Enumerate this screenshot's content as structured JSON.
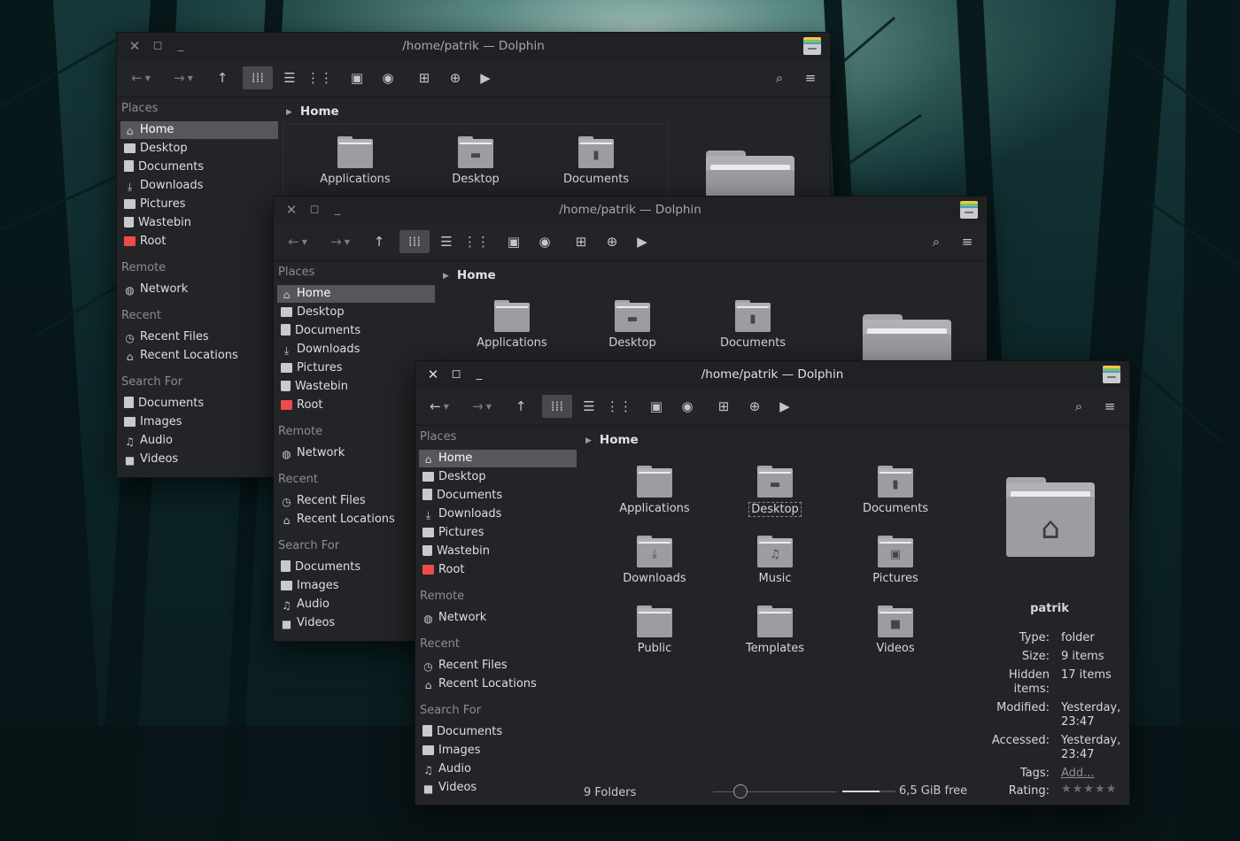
{
  "window": {
    "title": "/home/patrik — Dolphin",
    "breadcrumb": "Home"
  },
  "sidebar": {
    "places_label": "Places",
    "places": [
      {
        "label": "Home",
        "icon": "home-icon"
      },
      {
        "label": "Desktop",
        "icon": "desktop-icon"
      },
      {
        "label": "Documents",
        "icon": "document-icon"
      },
      {
        "label": "Downloads",
        "icon": "download-icon"
      },
      {
        "label": "Pictures",
        "icon": "image-icon"
      },
      {
        "label": "Wastebin",
        "icon": "trash-icon"
      },
      {
        "label": "Root",
        "icon": "root-folder-icon"
      }
    ],
    "remote_label": "Remote",
    "remote": [
      {
        "label": "Network",
        "icon": "globe-icon"
      }
    ],
    "recent_label": "Recent",
    "recent": [
      {
        "label": "Recent Files",
        "icon": "clock-icon"
      },
      {
        "label": "Recent Locations",
        "icon": "recent-locations-icon"
      }
    ],
    "search_label": "Search For",
    "search": [
      {
        "label": "Documents",
        "icon": "document-icon"
      },
      {
        "label": "Images",
        "icon": "image-icon"
      },
      {
        "label": "Audio",
        "icon": "music-note-icon"
      },
      {
        "label": "Videos",
        "icon": "video-icon"
      }
    ]
  },
  "folders": [
    {
      "label": "Applications",
      "icon": "folder-icon"
    },
    {
      "label": "Desktop",
      "icon": "folder-desktop-icon"
    },
    {
      "label": "Documents",
      "icon": "folder-documents-icon"
    },
    {
      "label": "Downloads",
      "icon": "folder-downloads-icon"
    },
    {
      "label": "Music",
      "icon": "folder-music-icon"
    },
    {
      "label": "Pictures",
      "icon": "folder-pictures-icon"
    },
    {
      "label": "Public",
      "icon": "folder-icon"
    },
    {
      "label": "Templates",
      "icon": "folder-icon"
    },
    {
      "label": "Videos",
      "icon": "folder-videos-icon"
    }
  ],
  "status": {
    "folders_count": "9 Folders",
    "free_space": "6,5 GiB free"
  },
  "info_panel": {
    "name": "patrik",
    "type_label": "Type:",
    "type_value": "folder",
    "size_label": "Size:",
    "size_value": "9 items",
    "hidden_label_1": "Hidden",
    "hidden_label_2": "items:",
    "hidden_value": "17 items",
    "modified_label": "Modified:",
    "modified_value_1": "Yesterday,",
    "modified_value_2": "23:47",
    "accessed_label": "Accessed:",
    "accessed_value_1": "Yesterday,",
    "accessed_value_2": "23:47",
    "tags_label": "Tags:",
    "tags_value": "Add...",
    "rating_label": "Rating:",
    "rating_value": "0/5"
  },
  "colors": {
    "accent_root": "#ec4b48",
    "window_bg": "#232427"
  }
}
